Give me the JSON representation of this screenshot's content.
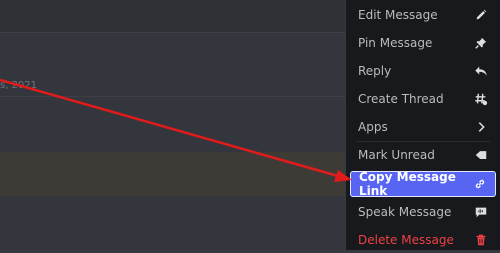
{
  "chat": {
    "date_fragment": "s, 2021"
  },
  "context_menu": {
    "items": [
      {
        "label": "Edit Message",
        "icon": "pencil-icon"
      },
      {
        "label": "Pin Message",
        "icon": "pin-icon"
      },
      {
        "label": "Reply",
        "icon": "reply-icon"
      },
      {
        "label": "Create Thread",
        "icon": "thread-icon"
      },
      {
        "label": "Apps",
        "icon": "chevron-right-icon"
      },
      {
        "label": "Mark Unread",
        "icon": "mark-unread-icon"
      },
      {
        "label": "Copy Message Link",
        "icon": "link-icon",
        "state": "hovered"
      },
      {
        "label": "Speak Message",
        "icon": "speak-icon"
      },
      {
        "label": "Delete Message",
        "icon": "trash-icon"
      }
    ]
  },
  "colors": {
    "accent": "#5865f2",
    "danger": "#ed4245",
    "annotation_arrow": "#e01b1b"
  }
}
